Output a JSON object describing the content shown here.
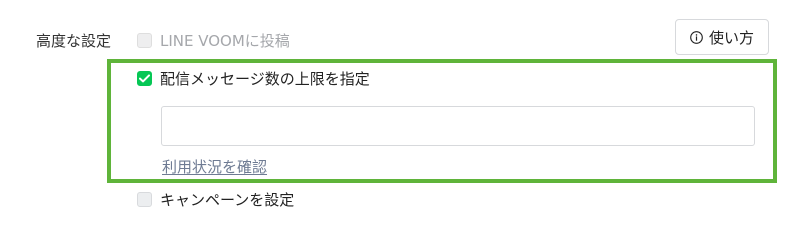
{
  "section": {
    "label": "高度な設定"
  },
  "options": {
    "voom": {
      "label": "LINE VOOMに投稿",
      "checked": false,
      "disabled": true
    },
    "message_limit": {
      "label": "配信メッセージ数の上限を指定",
      "checked": true,
      "input_value": "",
      "input_placeholder": "",
      "usage_link": "利用状況を確認"
    },
    "campaign": {
      "label": "キャンペーンを設定",
      "checked": false
    }
  },
  "help_button": {
    "label": "使い方",
    "icon": "info-icon"
  },
  "colors": {
    "accent_green": "#06c755",
    "highlight_border": "#5fb43a",
    "link": "#6e7b93"
  }
}
